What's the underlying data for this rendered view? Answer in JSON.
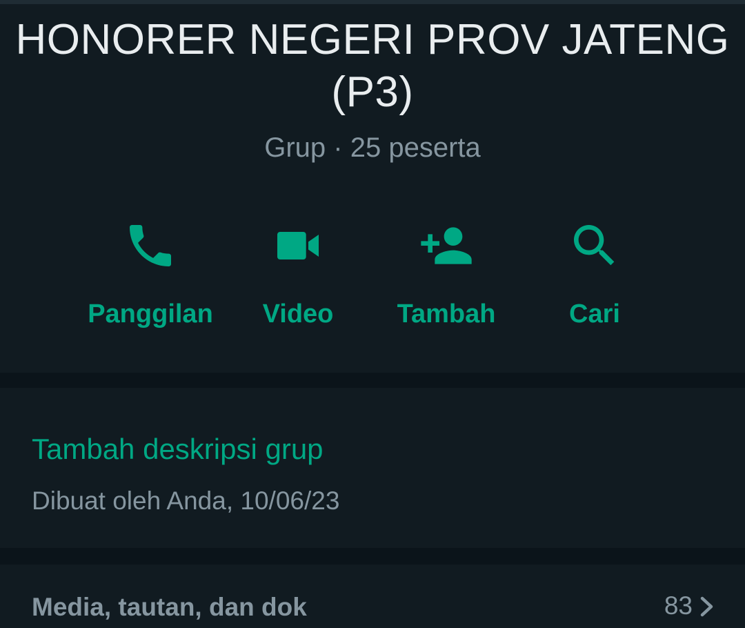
{
  "group": {
    "name": "HONORER NEGERI PROV JATENG (P3)",
    "subtitle": "Grup · 25 peserta"
  },
  "actions": [
    {
      "label": "Panggilan",
      "icon": "phone-icon"
    },
    {
      "label": "Video",
      "icon": "video-camera-icon"
    },
    {
      "label": "Tambah",
      "icon": "add-person-icon"
    },
    {
      "label": "Cari",
      "icon": "search-icon"
    }
  ],
  "description": {
    "add_link": "Tambah deskripsi grup",
    "created": "Dibuat oleh Anda, 10/06/23"
  },
  "media": {
    "label": "Media, tautan, dan dok",
    "count": "83"
  },
  "colors": {
    "background": "#0b141a",
    "card": "#111b21",
    "accent": "#00a884",
    "primary_text": "#e9edef",
    "secondary_text": "#8696a0"
  }
}
